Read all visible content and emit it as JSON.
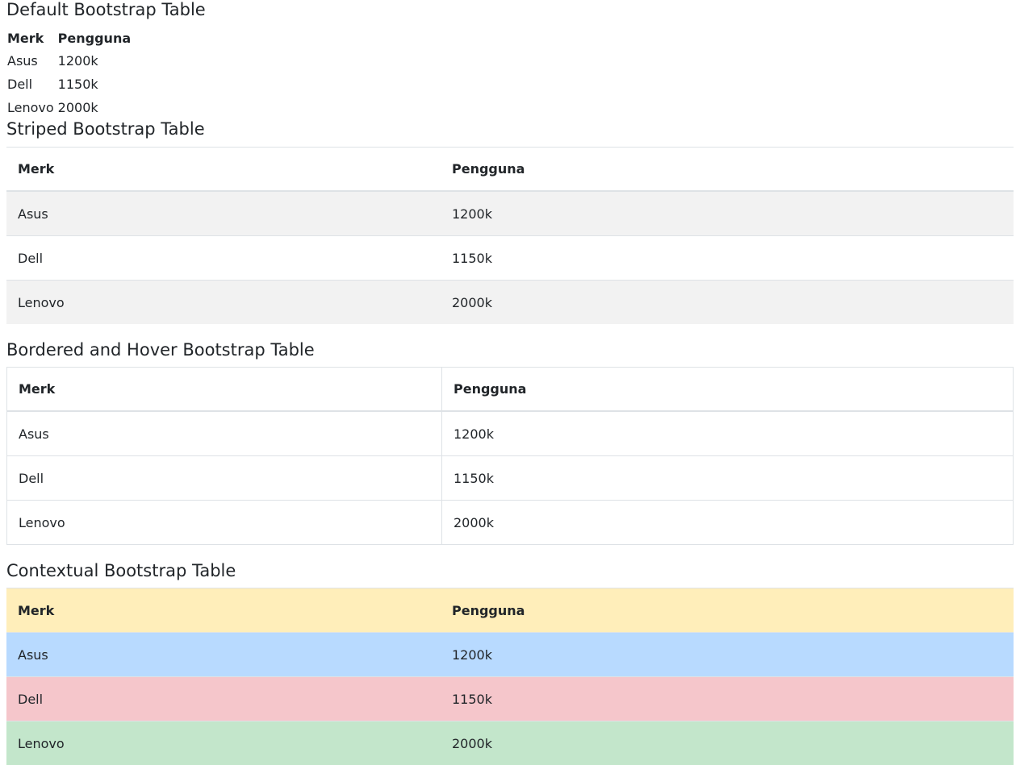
{
  "sections": {
    "default": {
      "title": "Default Bootstrap Table"
    },
    "striped": {
      "title": "Striped Bootstrap Table"
    },
    "bordered": {
      "title": "Bordered and Hover Bootstrap Table"
    },
    "contextual": {
      "title": "Contextual Bootstrap Table"
    }
  },
  "columns": [
    "Merk",
    "Pengguna"
  ],
  "rows": [
    {
      "merk": "Asus",
      "pengguna": "1200k"
    },
    {
      "merk": "Dell",
      "pengguna": "1150k"
    },
    {
      "merk": "Lenovo",
      "pengguna": "2000k"
    }
  ],
  "colors": {
    "stripe": "#f2f2f2",
    "border": "#dee2e6",
    "warning": "#ffeeba",
    "primary": "#b8daff",
    "danger": "#f5c6cb",
    "success": "#c3e6cb"
  }
}
